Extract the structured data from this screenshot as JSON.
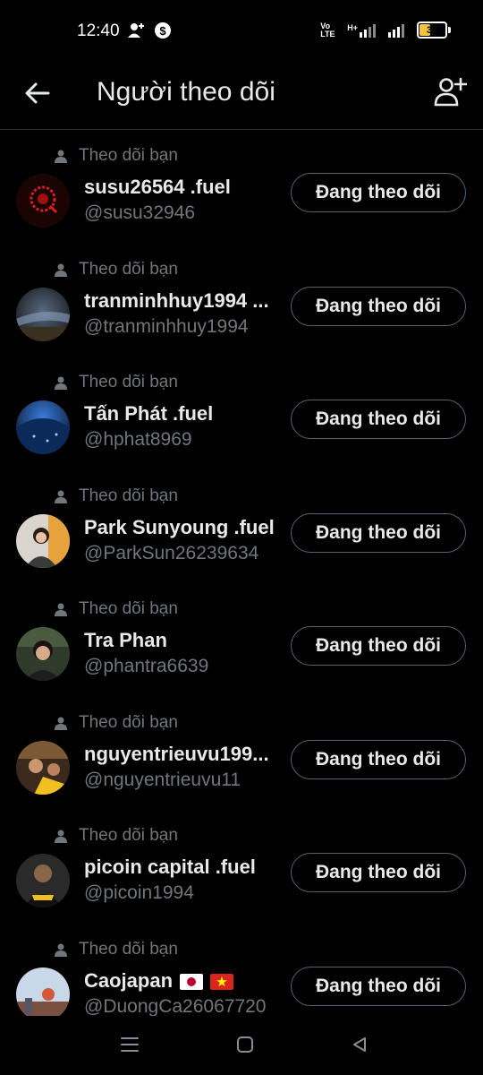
{
  "status_bar": {
    "time": "12:40",
    "network_label": "Vo LTE",
    "signal_label": "H+",
    "battery": "39",
    "icons": [
      "add-person-notify-icon",
      "dollar-circle-icon",
      "volte-icon",
      "signal-icon",
      "signal-icon",
      "battery-icon"
    ]
  },
  "header": {
    "title": "Người theo dõi",
    "back_icon": "arrow-left-icon",
    "add_icon": "add-user-icon"
  },
  "followers": [
    {
      "follows_you": "Theo dõi bạn",
      "name": "susu26564 .fuel",
      "handle": "@susu32946",
      "button": "Đang theo dõi",
      "flags": []
    },
    {
      "follows_you": "Theo dõi bạn",
      "name": "tranminhhuy1994 ...",
      "handle": "@tranminhhuy1994",
      "button": "Đang theo dõi",
      "flags": []
    },
    {
      "follows_you": "Theo dõi bạn",
      "name": "Tấn Phát .fuel",
      "handle": "@hphat8969",
      "button": "Đang theo dõi",
      "flags": []
    },
    {
      "follows_you": "Theo dõi bạn",
      "name": "Park Sunyoung .fuel",
      "handle": "@ParkSun26239634",
      "button": "Đang theo dõi",
      "flags": []
    },
    {
      "follows_you": "Theo dõi bạn",
      "name": "Tra Phan",
      "handle": "@phantra6639",
      "button": "Đang theo dõi",
      "flags": []
    },
    {
      "follows_you": "Theo dõi bạn",
      "name": "nguyentrieuvu199...",
      "handle": "@nguyentrieuvu11",
      "button": "Đang theo dõi",
      "flags": []
    },
    {
      "follows_you": "Theo dõi bạn",
      "name": "picoin capital .fuel",
      "handle": "@picoin1994",
      "button": "Đang theo dõi",
      "flags": []
    },
    {
      "follows_you": "Theo dõi bạn",
      "name": "Caojapan",
      "handle": "@DuongCa26067720",
      "button": "Đang theo dõi",
      "flags": [
        "japan-flag-icon",
        "vietnam-flag-icon"
      ]
    }
  ],
  "nav_bar": {
    "icons": [
      "menu-icon",
      "home-square-icon",
      "back-triangle-icon"
    ]
  },
  "colors": {
    "background": "#000000",
    "text_primary": "#e7e9ea",
    "text_secondary": "#71767b",
    "button_border": "#536471",
    "divider": "#2f3336"
  }
}
